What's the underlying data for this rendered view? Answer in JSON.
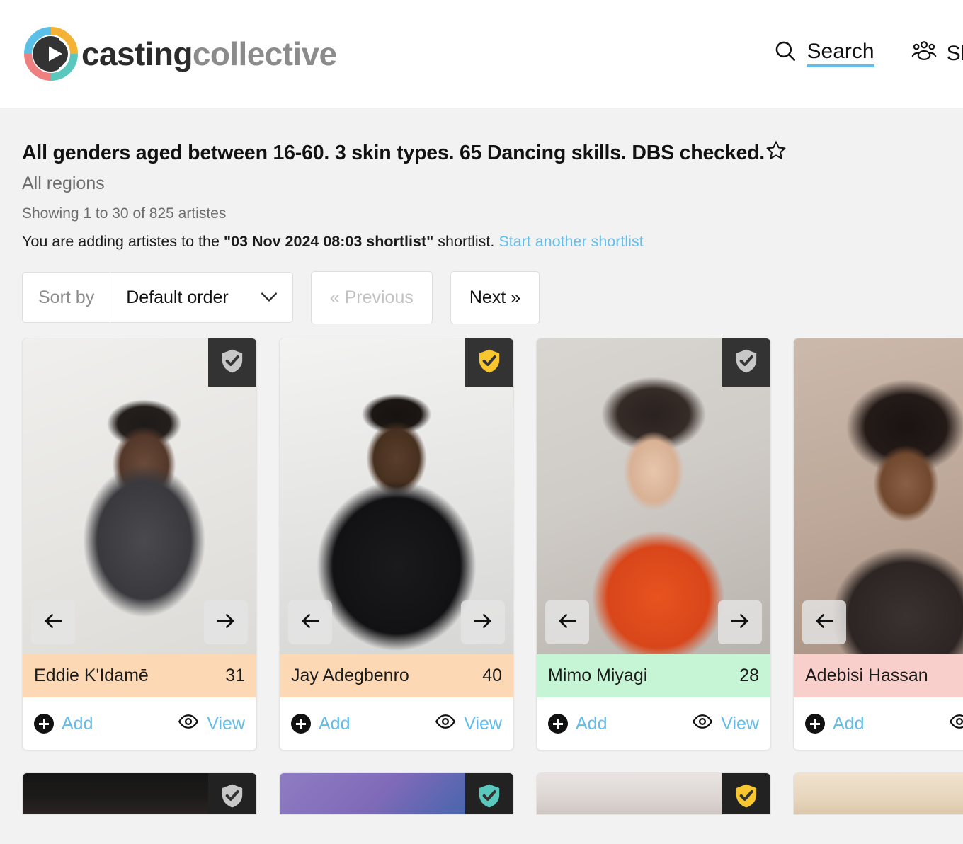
{
  "header": {
    "brand_primary": "casting",
    "brand_secondary": "collective",
    "logo_icon": "play-circle-logo",
    "nav": [
      {
        "icon": "search-icon",
        "label": "Search",
        "underlined": true
      },
      {
        "icon": "people-group-icon",
        "label": "Sho",
        "underlined": false
      }
    ]
  },
  "search_summary": {
    "title": "All genders aged between 16-60. 3 skin types. 65 Dancing skills. DBS checked.",
    "favourite_icon": "star-outline-icon",
    "region": "All regions",
    "showing": "Showing 1 to 30 of 825 artistes",
    "adding_prefix": "You are adding artistes to the ",
    "shortlist_name": "\"03 Nov 2024 08:03 shortlist\"",
    "adding_suffix": " shortlist. ",
    "start_another_link": "Start another shortlist"
  },
  "toolbar": {
    "sort_label": "Sort by",
    "sort_value": "Default order",
    "sort_chevron_icon": "chevron-down-icon",
    "previous_label": "« Previous",
    "previous_disabled": true,
    "next_label": "Next »"
  },
  "colors": {
    "accent_blue": "#62bdea",
    "name_bar_peach": "#fcd9b4",
    "name_bar_green": "#c6f5d5",
    "name_bar_pink": "#f9cfcb",
    "badge_gold": "#f8c62e",
    "badge_grey": "#c7c7c7",
    "badge_teal": "#5ac8bd",
    "page_background": "#f2f2f2"
  },
  "card_actions": {
    "add_label": "Add",
    "add_icon": "plus-circle-icon",
    "view_label": "View",
    "view_icon": "eye-icon",
    "prev_photo_icon": "arrow-left-icon",
    "next_photo_icon": "arrow-right-icon",
    "verified_icon": "shield-check-icon"
  },
  "cards": [
    {
      "name": "Eddie K'Idamē",
      "age": "31",
      "name_bar_color": "#fcd9b4",
      "badge_color": "#c7c7c7",
      "photo_class": "ph-eddie"
    },
    {
      "name": "Jay Adegbenro",
      "age": "40",
      "name_bar_color": "#fcd9b4",
      "badge_color": "#f8c62e",
      "photo_class": "ph-jay"
    },
    {
      "name": "Mimo Miyagi",
      "age": "28",
      "name_bar_color": "#c6f5d5",
      "badge_color": "#c7c7c7",
      "photo_class": "ph-mimo"
    },
    {
      "name": "Adebisi Hassan",
      "age": "",
      "name_bar_color": "#f9cfcb",
      "badge_color": "",
      "photo_class": "ph-adebisi"
    }
  ],
  "cards_row2": [
    {
      "badge_color": "#c7c7c7",
      "photo_class": "ph-r2a"
    },
    {
      "badge_color": "#5ac8bd",
      "photo_class": "ph-r2b"
    },
    {
      "badge_color": "#f8c62e",
      "photo_class": "ph-r2c"
    },
    {
      "badge_color": "",
      "photo_class": "ph-r2d"
    }
  ]
}
